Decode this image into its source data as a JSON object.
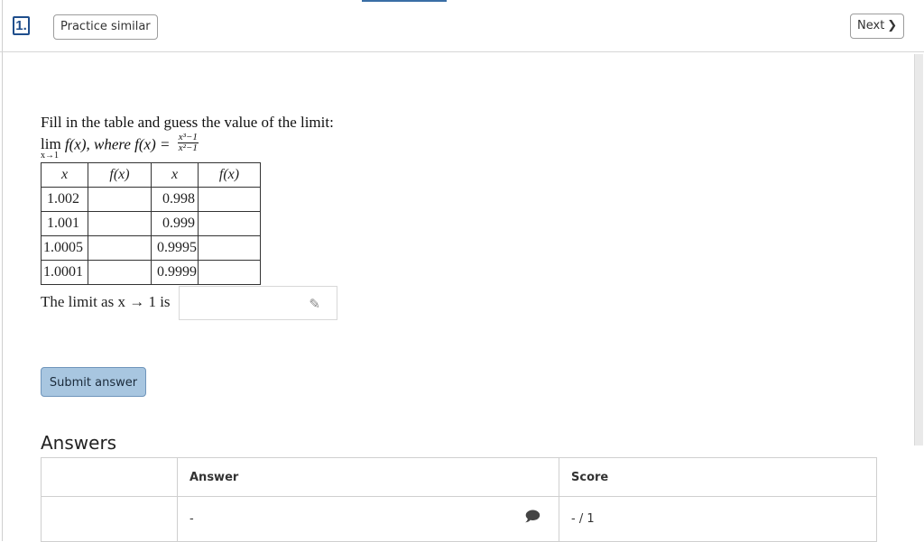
{
  "header": {
    "question_number": "1.",
    "practice_label": "Practice similar",
    "next_label": "Next",
    "next_chevron": "❯"
  },
  "question": {
    "instruction": "Fill in the table and guess the value of the limit:",
    "lim_word": "lim",
    "lim_sub": "x→1",
    "func_text": "f(x), where f(x) =",
    "numerator": "x³−1",
    "denominator": "x²−1",
    "table": {
      "headers": [
        "x",
        "f(x)",
        "x",
        "f(x)"
      ],
      "rows": [
        {
          "x1": "1.002",
          "f1": "",
          "x2": "0.998",
          "f2": ""
        },
        {
          "x1": "1.001",
          "f1": "",
          "x2": "0.999",
          "f2": ""
        },
        {
          "x1": "1.0005",
          "f1": "",
          "x2": "0.9995",
          "f2": ""
        },
        {
          "x1": "1.0001",
          "f1": "",
          "x2": "0.9999",
          "f2": ""
        }
      ]
    },
    "limit_prompt": "The limit as x → 1 is",
    "answer_value": ""
  },
  "submit_label": "Submit answer",
  "answers_section": {
    "title": "Answers",
    "columns": [
      "",
      "Answer",
      "Score"
    ],
    "row": {
      "col1": "",
      "answer": "-",
      "score": "- / 1"
    }
  },
  "icons": {
    "pencil": "✎",
    "note": "🗩"
  },
  "colors": {
    "accent": "#1f4e8c",
    "submit_bg": "#a8c6e0"
  }
}
